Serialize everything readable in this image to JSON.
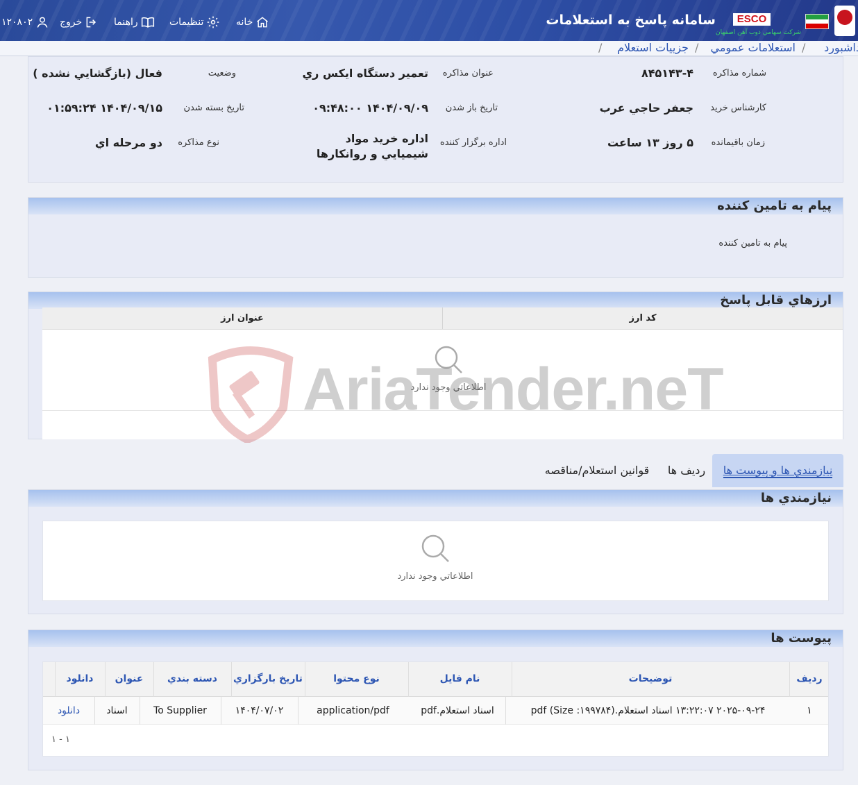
{
  "header": {
    "app_title": "سامانه پاسخ به استعلامات",
    "logo_text": "ESCO",
    "company_name": "شركت سهامي ذوب آهن اصفهان",
    "nav": {
      "home": "خانه",
      "settings": "تنظيمات",
      "guide": "راهنما",
      "logout": "خروج",
      "user_id": "۱۲۰۸۰۲"
    }
  },
  "breadcrumb": {
    "items": [
      "داشبورد",
      "استعلامات عمومي",
      "جزييات استعلام"
    ]
  },
  "details": {
    "negotiation_number_label": "شماره مذاكره",
    "negotiation_number": "۸۴۵۱۴۳-۴",
    "negotiation_title_label": "عنوان مذاكره",
    "negotiation_title": "تعمير دستگاه ايكس ري",
    "status_label": "وضعيت",
    "status": "فعال (بازگشايي نشده )",
    "purchase_expert_label": "كارشناس خريد",
    "purchase_expert": "جعفر حاجي عرب",
    "open_date_label": "تاريخ باز شدن",
    "open_date": "۱۴۰۴/۰۹/۰۹ ۰۹:۴۸:۰۰",
    "close_date_label": "تاريخ بسته شدن",
    "close_date": "۱۴۰۴/۰۹/۱۵ ۰۱:۵۹:۲۴",
    "remaining_label": "زمان باقيمانده",
    "remaining": "۵ روز ۱۳ ساعت",
    "organizer_label": "اداره برگزار كننده",
    "organizer_line1": "اداره خريد مواد",
    "organizer_line2": "شيميايي و روانكارها",
    "type_label": "نوع مذاكره",
    "type": "دو مرحله اي"
  },
  "supplier_message": {
    "title": "پيام به تامين كننده",
    "text": "پيام به تامين كننده"
  },
  "currencies": {
    "title": "ارزهاي قابل پاسخ",
    "columns": [
      "كد ارز",
      "عنوان ارز"
    ],
    "empty_text": "اطلاعاتي وجود ندارد"
  },
  "tabs": {
    "items": [
      "نيازمندي ها و پيوست ها",
      "رديف ها",
      "قوانين استعلام/مناقصه"
    ],
    "active_index": 0
  },
  "requirements": {
    "title": "نيازمندي ها",
    "empty_text": "اطلاعاتي وجود ندارد"
  },
  "attachments": {
    "title": "پيوست ها",
    "columns": [
      "رديف",
      "توضيحات",
      "نام فايل",
      "نوع محتوا",
      "تاريخ بارگزاري",
      "دسته بندي",
      "عنوان",
      "دانلود"
    ],
    "rows": [
      {
        "index": "۱",
        "description": "۲۰۲۵-۰۹-۲۴ ۱۳:۲۲:۰۷ اسناد استعلام.(Size :۱۹۹۷۸۴) pdf",
        "file_name": "اسناد استعلام.pdf",
        "content_type": "application/pdf",
        "upload_date": "۱۴۰۴/۰۷/۰۲",
        "category": "To Supplier",
        "title": "اسناد",
        "download": "دانلود"
      }
    ],
    "pager": "۱ - ۱"
  },
  "watermark": {
    "text": "AriaTender.neT"
  },
  "colors": {
    "header_bg": "#2e4fa6",
    "link": "#2d56b3",
    "panel_bg": "#e8ebf6",
    "panel_head": "#a6c1ee",
    "tab_active": "#c7d6f3"
  }
}
